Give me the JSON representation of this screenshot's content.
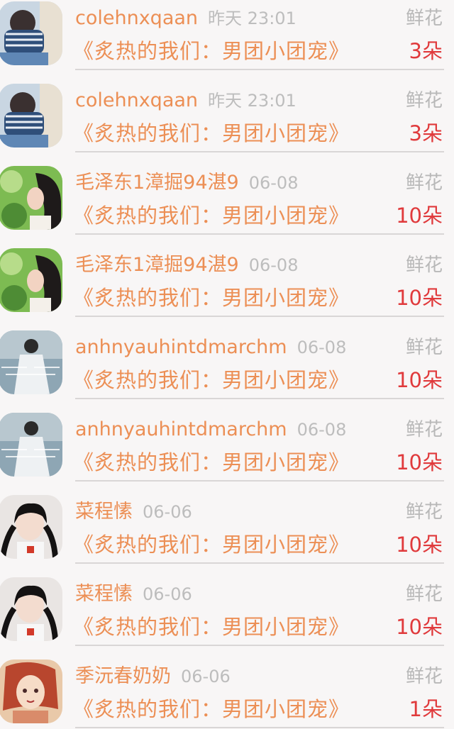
{
  "gift_list": [
    {
      "user": "colehnxqaan",
      "time": "昨天 23:01",
      "gift_type": "鲜花",
      "book": "《炙热的我们：男团小团宠》",
      "count": "3朵",
      "avatar": "avatar-girl-striped-shirt"
    },
    {
      "user": "colehnxqaan",
      "time": "昨天 23:01",
      "gift_type": "鲜花",
      "book": "《炙热的我们：男团小团宠》",
      "count": "3朵",
      "avatar": "avatar-girl-striped-shirt"
    },
    {
      "user": "毛泽东1漳掘94湛9",
      "time": "06-08",
      "gift_type": "鲜花",
      "book": "《炙热的我们：男团小团宠》",
      "count": "10朵",
      "avatar": "avatar-girl-green-leaves"
    },
    {
      "user": "毛泽东1漳掘94湛9",
      "time": "06-08",
      "gift_type": "鲜花",
      "book": "《炙热的我们：男团小团宠》",
      "count": "10朵",
      "avatar": "avatar-girl-green-leaves"
    },
    {
      "user": "anhnyauhintdmarchm",
      "time": "06-08",
      "gift_type": "鲜花",
      "book": "《炙热的我们：男团小团宠》",
      "count": "10朵",
      "avatar": "avatar-girl-white-dress"
    },
    {
      "user": "anhnyauhintdmarchm",
      "time": "06-08",
      "gift_type": "鲜花",
      "book": "《炙热的我们：男团小团宠》",
      "count": "10朵",
      "avatar": "avatar-girl-white-dress"
    },
    {
      "user": "菜程愫",
      "time": "06-06",
      "gift_type": "鲜花",
      "book": "《炙热的我们：男团小团宠》",
      "count": "10朵",
      "avatar": "avatar-girl-braids"
    },
    {
      "user": "菜程愫",
      "time": "06-06",
      "gift_type": "鲜花",
      "book": "《炙热的我们：男团小团宠》",
      "count": "10朵",
      "avatar": "avatar-girl-braids"
    },
    {
      "user": "季沅春奶奶",
      "time": "06-06",
      "gift_type": "鲜花",
      "book": "《炙热的我们：男团小团宠》",
      "count": "1朵",
      "avatar": "avatar-anime-girl"
    }
  ],
  "avatar_colors": {
    "avatar-girl-striped-shirt": "#9cb3c7",
    "avatar-girl-green-leaves": "#6fae4a",
    "avatar-girl-white-dress": "#7f98a8",
    "avatar-girl-braids": "#d9d4d2",
    "avatar-anime-girl": "#d7a27e"
  },
  "accent_colors": {
    "name": "#ec8f55",
    "count": "#e03a3c",
    "muted": "#bdbdbd"
  }
}
